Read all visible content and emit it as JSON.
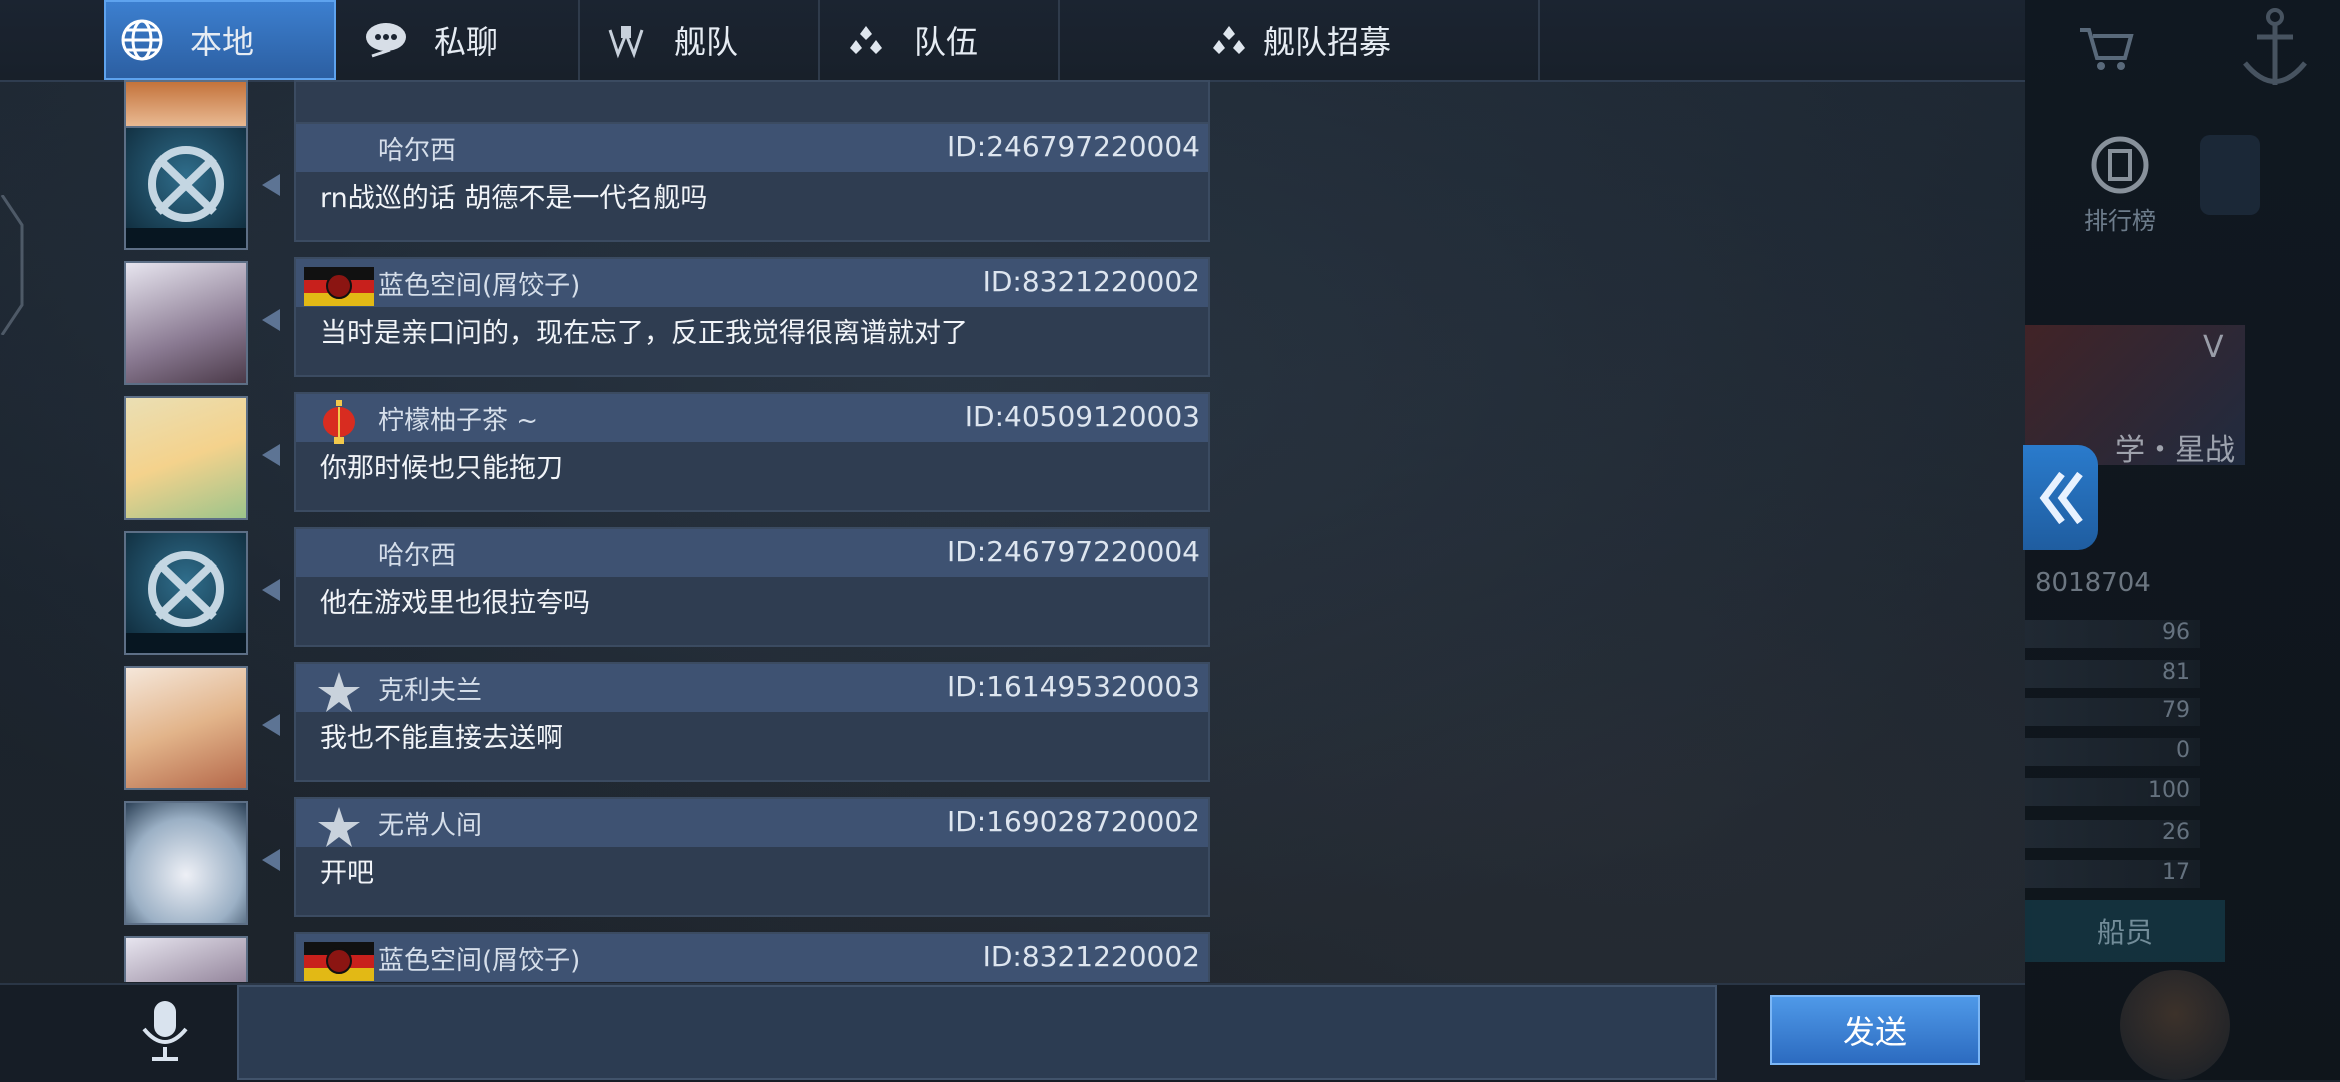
{
  "tabs": [
    {
      "label": "本地",
      "icon": "globe-icon",
      "active": true
    },
    {
      "label": "私聊",
      "icon": "chat-bubbles-icon",
      "active": false
    },
    {
      "label": "舰队",
      "icon": "fleet-emblem-icon",
      "active": false
    },
    {
      "label": "队伍",
      "icon": "team-dots-icon",
      "active": false
    },
    {
      "label": "舰队招募",
      "icon": "team-dots-icon",
      "active": false
    }
  ],
  "messages": [
    {
      "name": "哈尔西",
      "id": "ID:246797220004",
      "text": "rn战巡的话 胡德不是一代名舰吗",
      "badge": ""
    },
    {
      "name": "蓝色空间(屑饺子)",
      "id": "ID:8321220002",
      "text": "当时是亲口问的，现在忘了，反正我觉得很离谱就对了",
      "badge": "flag-badge"
    },
    {
      "name": "柠檬柚子茶 ~",
      "id": "ID:40509120003",
      "text": "你那时候也只能拖刀",
      "badge": "lantern-badge"
    },
    {
      "name": "哈尔西",
      "id": "ID:246797220004",
      "text": "他在游戏里也很拉夸吗",
      "badge": ""
    },
    {
      "name": "克利夫兰",
      "id": "ID:161495320003",
      "text": "我也不能直接去送啊",
      "badge": "star-badge"
    },
    {
      "name": "无常人间",
      "id": "ID:169028720002",
      "text": "开吧",
      "badge": "star-badge"
    },
    {
      "name": "蓝色空间(屑饺子)",
      "id": "ID:8321220002",
      "text": "",
      "badge": "flag-badge"
    }
  ],
  "input": {
    "value": ""
  },
  "send_label": "发送",
  "side": {
    "rank_label": "排行榜",
    "ship_name": "　学・星战",
    "tier": "V",
    "player_id": "8018704",
    "stats": [
      "96",
      "81",
      "79",
      "0",
      "100",
      "26",
      "17"
    ],
    "crew_label": "船员"
  },
  "colors": {
    "accent": "#3c7fcf",
    "bubble": "#2f3d51",
    "bubble_head": "#3e5272"
  }
}
